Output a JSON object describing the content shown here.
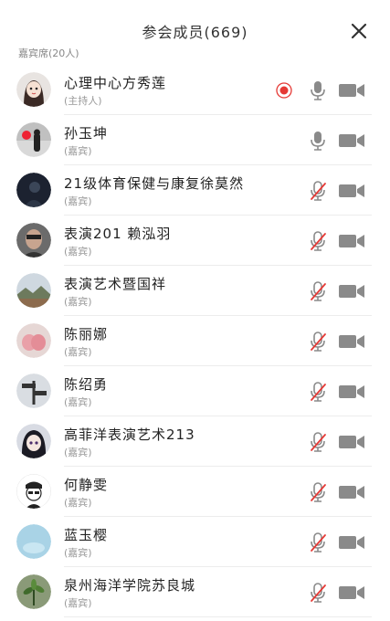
{
  "header": {
    "title": "参会成员(669)"
  },
  "section": {
    "label": "嘉宾席(20人)"
  },
  "members": [
    {
      "name": "心理中心方秀莲",
      "role": "(主持人)",
      "mic": "on",
      "recording": true,
      "avatar": "cartoon-girl"
    },
    {
      "name": "孙玉坤",
      "role": "(嘉宾)",
      "mic": "on",
      "recording": false,
      "avatar": "person-red-sky"
    },
    {
      "name": "21级体育保健与康复徐莫然",
      "role": "(嘉宾)",
      "mic": "muted",
      "recording": false,
      "avatar": "dark-photo"
    },
    {
      "name": "表演201 赖泓羽",
      "role": "(嘉宾)",
      "mic": "muted",
      "recording": false,
      "avatar": "portrait-grey"
    },
    {
      "name": "表演艺术暨国祥",
      "role": "(嘉宾)",
      "mic": "muted",
      "recording": false,
      "avatar": "landscape"
    },
    {
      "name": "陈丽娜",
      "role": "(嘉宾)",
      "mic": "muted",
      "recording": false,
      "avatar": "pink-blob"
    },
    {
      "name": "陈绍勇",
      "role": "(嘉宾)",
      "mic": "muted",
      "recording": false,
      "avatar": "signpost"
    },
    {
      "name": "高菲洋表演艺术213",
      "role": "(嘉宾)",
      "mic": "muted",
      "recording": false,
      "avatar": "anime-girl"
    },
    {
      "name": "何静雯",
      "role": "(嘉宾)",
      "mic": "muted",
      "recording": false,
      "avatar": "sketch-face"
    },
    {
      "name": "蓝玉樱",
      "role": "(嘉宾)",
      "mic": "muted",
      "recording": false,
      "avatar": "light-blue"
    },
    {
      "name": "泉州海洋学院苏良城",
      "role": "(嘉宾)",
      "mic": "muted",
      "recording": false,
      "avatar": "plant"
    }
  ],
  "colors": {
    "recording": "#e53935",
    "mute_slash": "#e53935",
    "icon_grey": "#8a8a8a"
  }
}
